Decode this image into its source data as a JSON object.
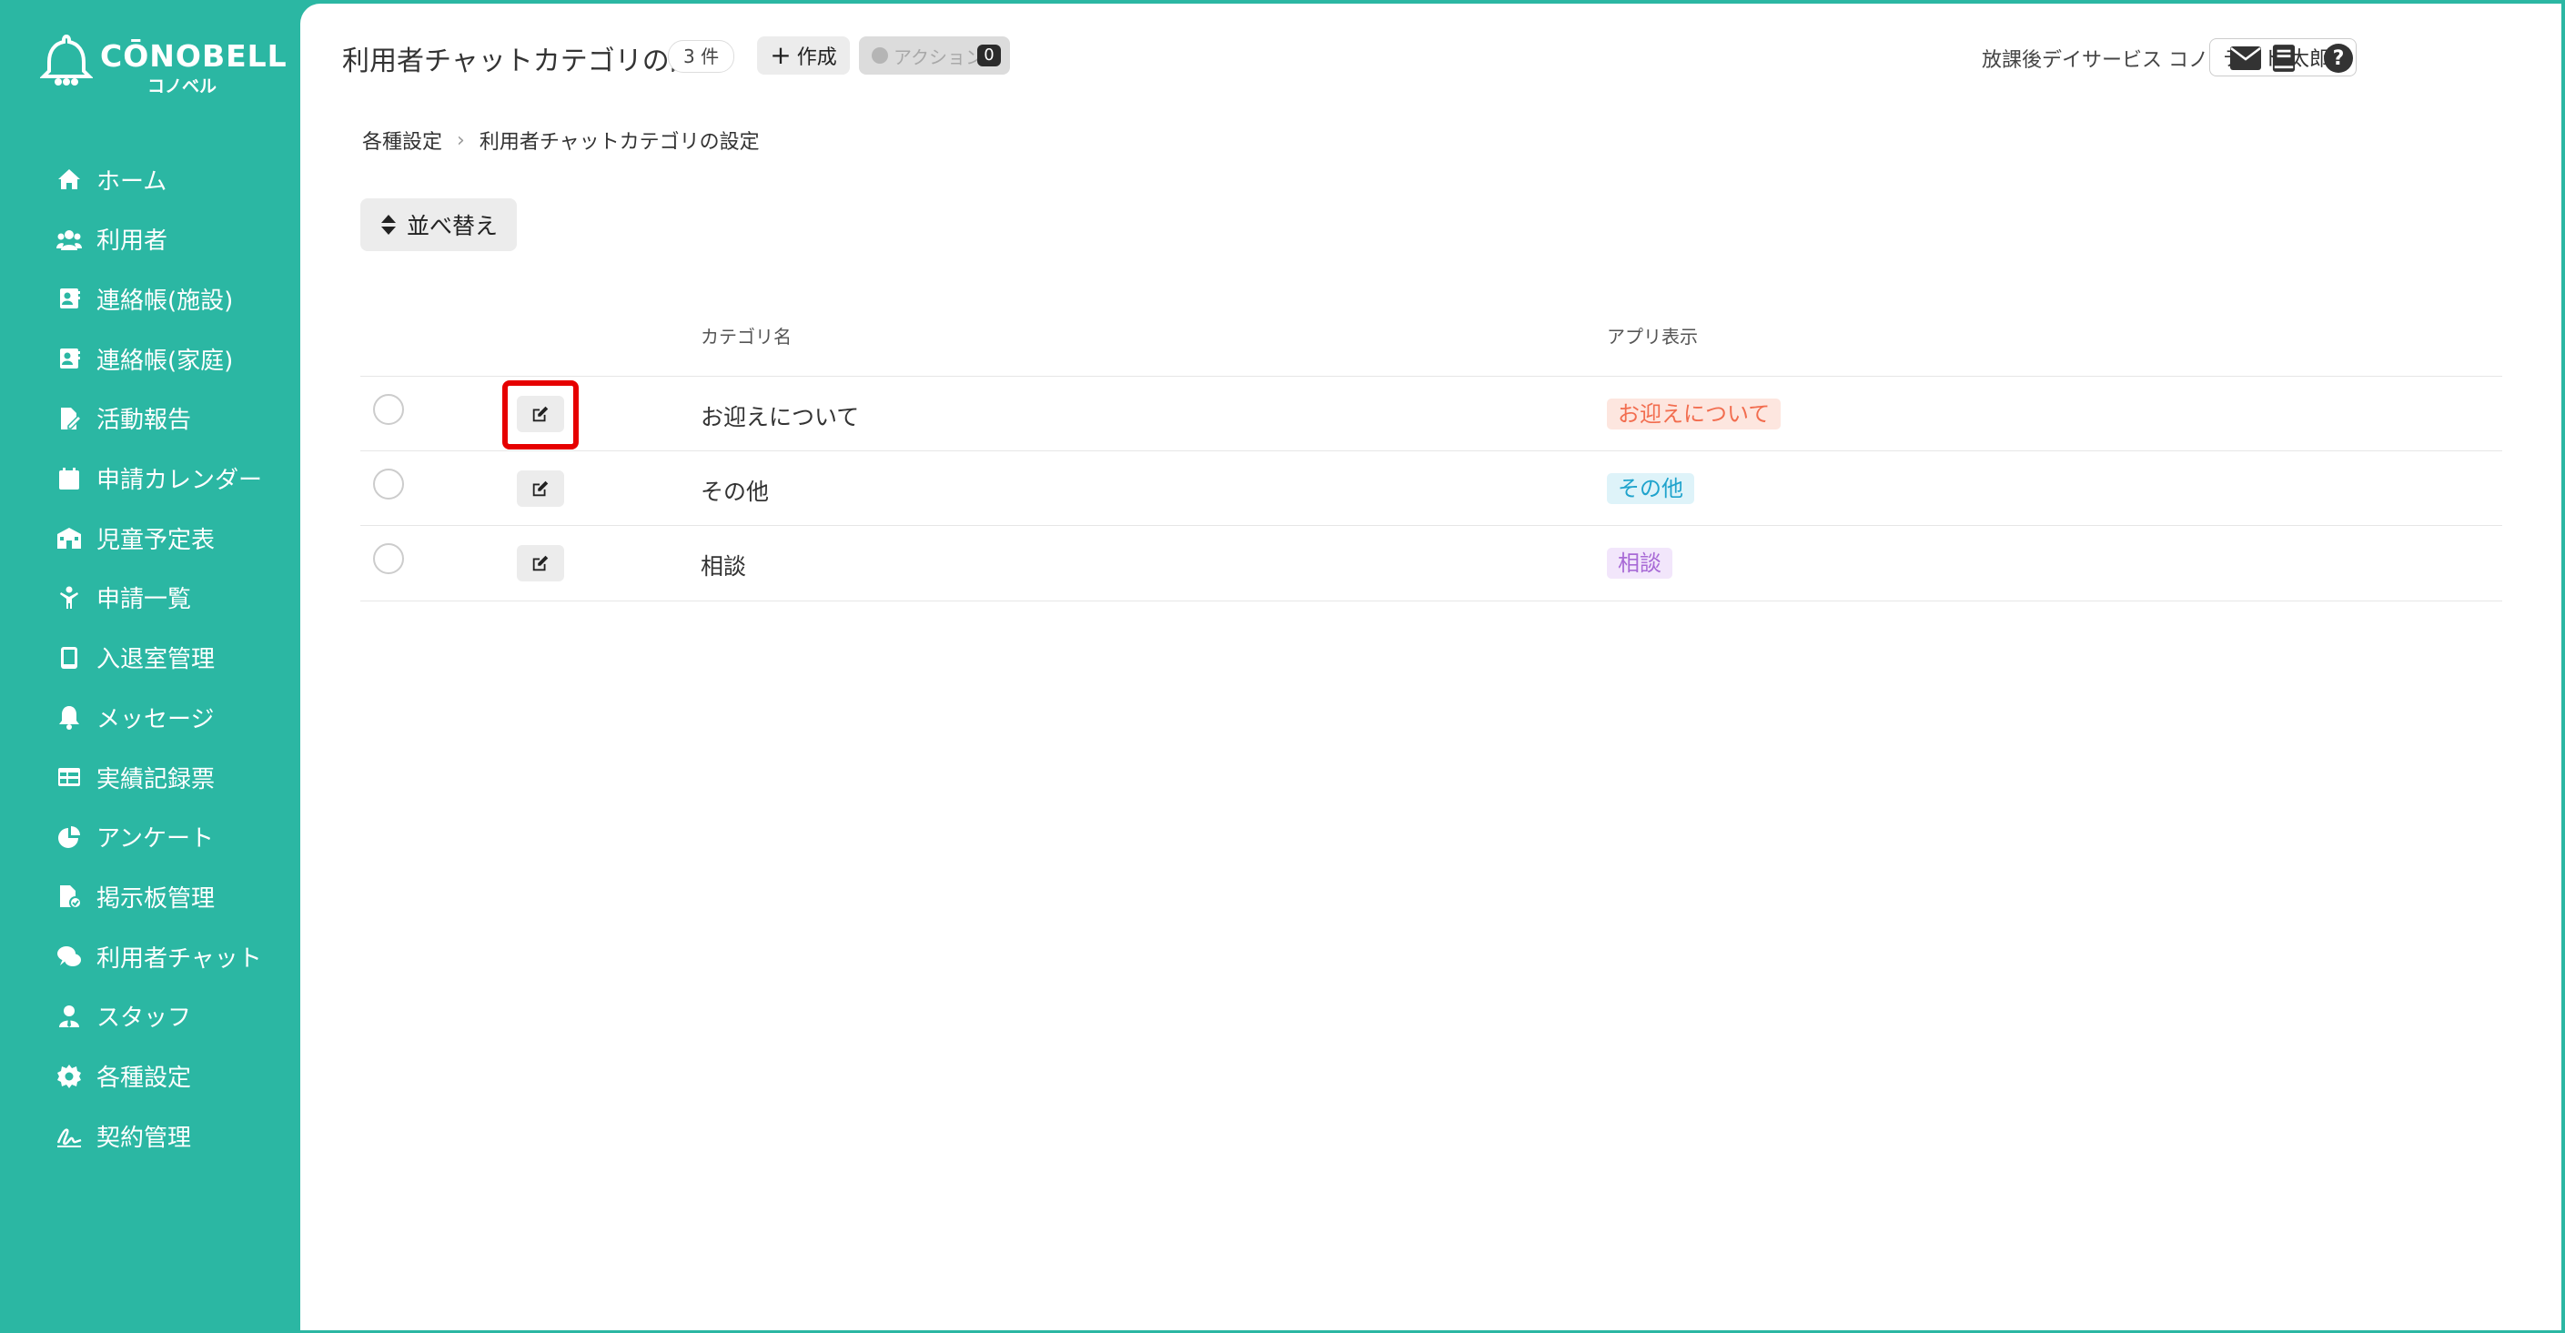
{
  "app": {
    "logo_text": "CŌNOBELL",
    "logo_sub": "コノベル"
  },
  "sidebar": {
    "items": [
      {
        "label": "ホーム",
        "icon": "home-icon"
      },
      {
        "label": "利用者",
        "icon": "users-icon"
      },
      {
        "label": "連絡帳(施設)",
        "icon": "contact-book-icon"
      },
      {
        "label": "連絡帳(家庭)",
        "icon": "contact-book-icon"
      },
      {
        "label": "活動報告",
        "icon": "file-pen-icon"
      },
      {
        "label": "申請カレンダー",
        "icon": "calendar-icon"
      },
      {
        "label": "児童予定表",
        "icon": "school-icon"
      },
      {
        "label": "申請一覧",
        "icon": "child-icon"
      },
      {
        "label": "入退室管理",
        "icon": "tablet-icon"
      },
      {
        "label": "メッセージ",
        "icon": "bell-icon"
      },
      {
        "label": "実績記録票",
        "icon": "table-icon"
      },
      {
        "label": "アンケート",
        "icon": "pie-chart-icon"
      },
      {
        "label": "掲示板管理",
        "icon": "file-check-icon"
      },
      {
        "label": "利用者チャット",
        "icon": "comments-icon"
      },
      {
        "label": "スタッフ",
        "icon": "user-tie-icon"
      },
      {
        "label": "各種設定",
        "icon": "gear-icon"
      },
      {
        "label": "契約管理",
        "icon": "signature-icon"
      }
    ]
  },
  "header": {
    "title": "利用者チャットカテゴリの設定",
    "count_badge": "3 件",
    "create_label": "作成",
    "action_label": "アクション",
    "action_count": "0",
    "facility_name": "放課後デイサービス コノベル",
    "user_name": "テスト 太郎"
  },
  "breadcrumb": {
    "parent": "各種設定",
    "current": "利用者チャットカテゴリの設定"
  },
  "toolbar": {
    "sort_label": "並べ替え"
  },
  "table": {
    "columns": {
      "category_name": "カテゴリ名",
      "app_display": "アプリ表示"
    },
    "rows": [
      {
        "name": "お迎えについて",
        "tag": "お迎えについて",
        "tag_text_color": "#f26d4f",
        "tag_bg_color": "#fde6df"
      },
      {
        "name": "その他",
        "tag": "その他",
        "tag_text_color": "#1fa3cc",
        "tag_bg_color": "#def3f9"
      },
      {
        "name": "相談",
        "tag": "相談",
        "tag_text_color": "#a86ad6",
        "tag_bg_color": "#f2e6fb"
      }
    ]
  },
  "colors": {
    "brand": "#2bb7a3",
    "highlight": "#e60000"
  }
}
